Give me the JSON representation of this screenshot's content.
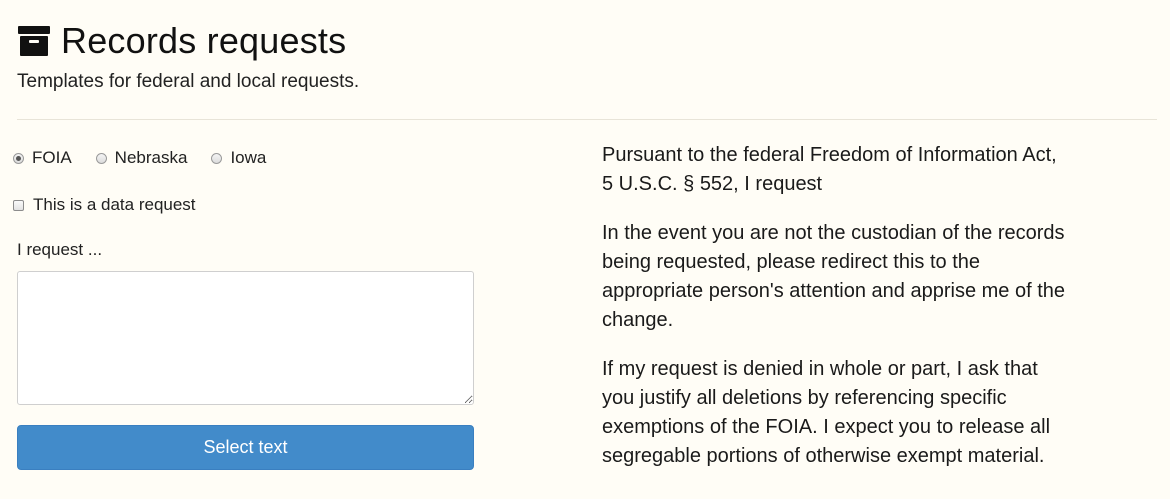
{
  "header": {
    "icon": "archive-box-icon",
    "title": "Records requests",
    "subtitle": "Templates for federal and local requests."
  },
  "form": {
    "jurisdictions": [
      {
        "label": "FOIA",
        "checked": true
      },
      {
        "label": "Nebraska",
        "checked": false
      },
      {
        "label": "Iowa",
        "checked": false
      }
    ],
    "data_request_label": "This is a data request",
    "data_request_checked": false,
    "request_label": "I request ...",
    "request_value": "",
    "select_button_label": "Select text"
  },
  "letter": {
    "paragraphs": [
      "Pursuant to the federal Freedom of Information Act, 5 U.S.C. § 552, I request",
      "In the event you are not the custodian of the records being requested, please redirect this to the appropriate person's attention and apprise me of the change.",
      "If my request is denied in whole or part, I ask that you justify all deletions by referencing specific exemptions of the FOIA. I expect you to release all segregable portions of otherwise exempt material."
    ]
  },
  "colors": {
    "background": "#fffdf6",
    "button": "#428bca",
    "button_text": "#ffffff"
  }
}
